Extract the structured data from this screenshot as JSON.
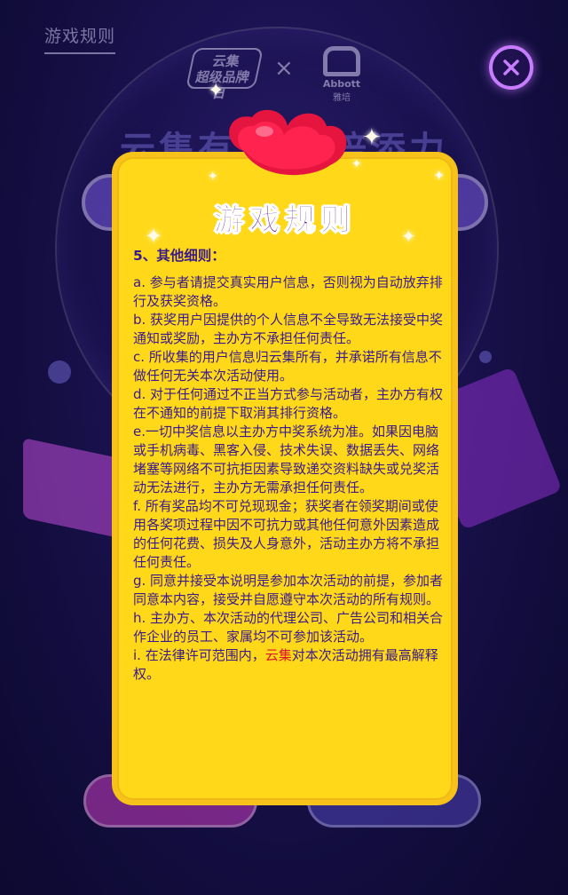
{
  "background": {
    "tab_label": "游戏规则",
    "headline": "云集有爱 雅培添力"
  },
  "dialog": {
    "title": "游戏规则",
    "section_heading": "5、其他细则：",
    "paragraphs": [
      "a. 参与者请提交真实用户信息，否则视为自动放弃排行及获奖资格。",
      "b. 获奖用户因提供的个人信息不全导致无法接受中奖通知或奖励，主办方不承担任何责任。",
      "c. 所收集的用户信息归云集所有，并承诺所有信息不做任何无关本次活动使用。",
      "d. 对于任何通过不正当方式参与活动者，主办方有权在不通知的前提下取消其排行资格。",
      "e.一切中奖信息以主办方中奖系统为准。如果因电脑或手机病毒、黑客入侵、技术失误、数据丢失、网络堵塞等网络不可抗拒因素导致递交资料缺失或兑奖活动无法进行，主办方无需承担任何责任。",
      "f. 所有奖品均不可兑现现金；获奖者在领奖期间或使用各奖项过程中因不可抗力或其他任何意外因素造成的任何花费、损失及人身意外，活动主办方将不承担任何责任。",
      "g.    同意并接受本说明是参加本次活动的前提，参加者同意本内容，接受并自愿遵守本次活动的所有规则。",
      "h. 主办方、本次活动的代理公司、广告公司和相关合作企业的员工、家属均不可参加该活动。"
    ],
    "last_paragraph": {
      "prefix": "i.  在法律许可范围内，",
      "highlight": "云集",
      "suffix": "对本次活动拥有最高解释权。"
    },
    "close_icon": "close-icon"
  },
  "colors": {
    "card": "#ffd919",
    "title": "#5a1690",
    "text": "#3a1a8a",
    "highlight": "#e0142a",
    "close_ring": "#c97cff"
  }
}
